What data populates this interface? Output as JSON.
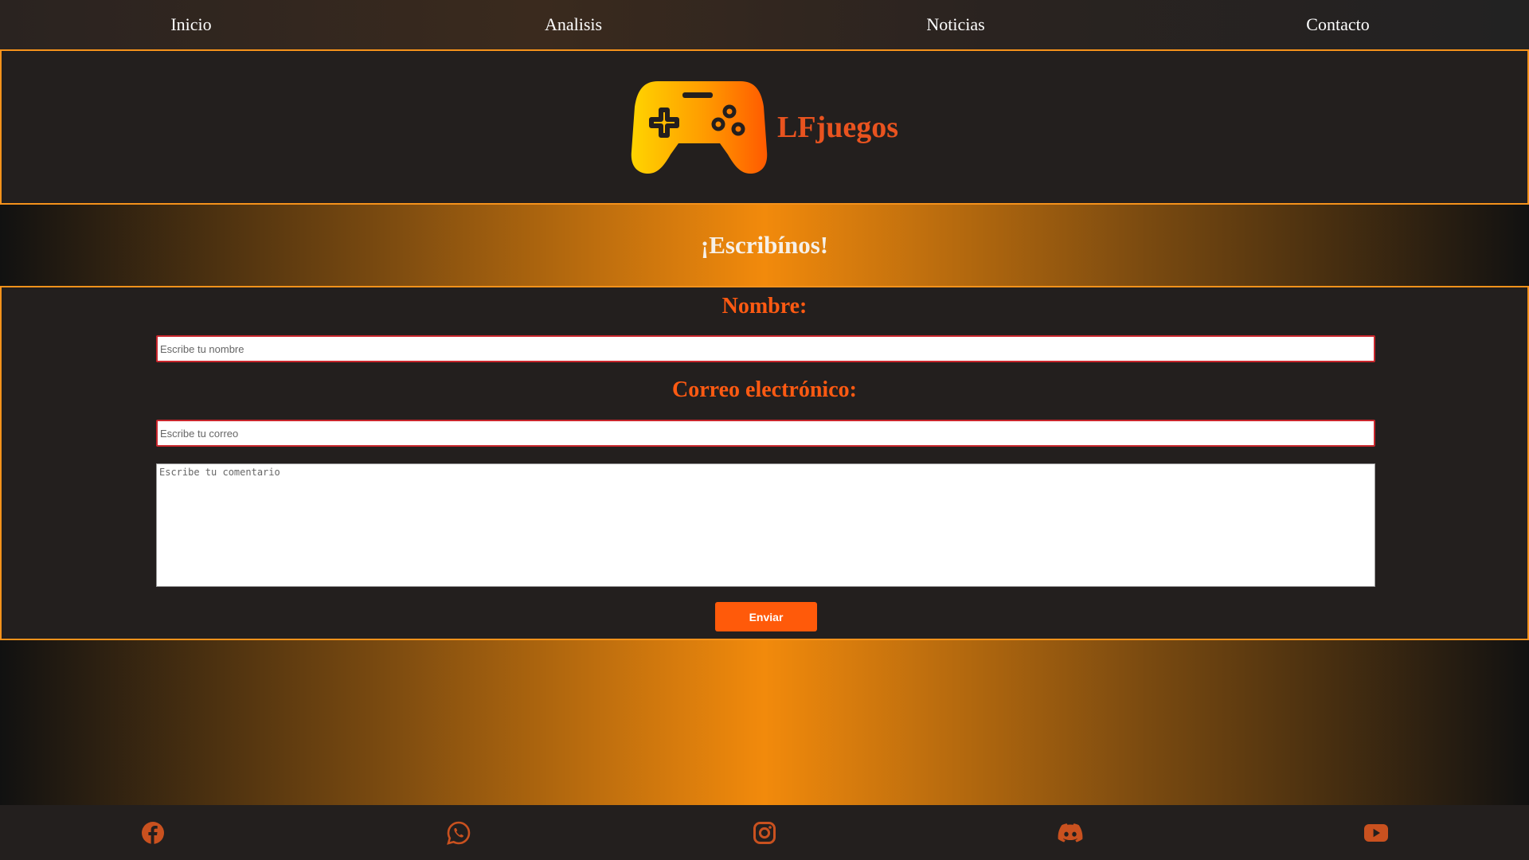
{
  "nav": {
    "items": [
      {
        "label": "Inicio"
      },
      {
        "label": "Analisis"
      },
      {
        "label": "Noticias"
      },
      {
        "label": "Contacto"
      }
    ]
  },
  "header": {
    "logo_icon": "gamepad-icon",
    "brand": "LFjuegos"
  },
  "banner": {
    "title": "¡Escribínos!"
  },
  "form": {
    "name_label": "Nombre:",
    "name_placeholder": "Escribe tu nombre",
    "email_label": "Correo electrónico:",
    "email_placeholder": "Escribe tu correo",
    "comment_placeholder": "Escribe tu comentario",
    "submit_label": "Enviar"
  },
  "footer": {
    "icons": [
      "facebook-icon",
      "whatsapp-icon",
      "instagram-icon",
      "discord-icon",
      "youtube-icon"
    ]
  },
  "colors": {
    "accent": "#ff5a12",
    "border": "#f5921b",
    "panel": "#231f1e",
    "brand_text": "#e9531f",
    "icon": "#c9511f"
  }
}
